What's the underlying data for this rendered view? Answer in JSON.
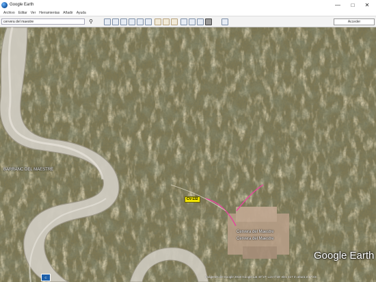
{
  "window": {
    "title": "Google Earth",
    "minimize": "—",
    "maximize": "□",
    "close": "✕"
  },
  "menu": [
    "Archivo",
    "Editar",
    "Ver",
    "Herramientas",
    "Añadir",
    "Ayuda"
  ],
  "toolbar": {
    "search_value": "cervera del maestre",
    "search_icon": "search-icon",
    "url_button": "Acceder"
  },
  "map": {
    "labels": {
      "area": "BARRANC DEL MAESTRE",
      "road": "CV-132",
      "town_1": "Cervera del Maestre",
      "town_2": "Cervera del Maestre"
    },
    "logo": "Google Earth"
  },
  "status": {
    "imagery": "Imágenes de Google  2016 Google     Lat  40°27'  Lon 0°16'  elev  417 m   altura  2.17 km",
    "badge": "C"
  },
  "colors": {
    "river": "#d6d2c8",
    "forest": "#3e4a2e",
    "field": "#b4a274",
    "road_shield": "#f3e600"
  }
}
